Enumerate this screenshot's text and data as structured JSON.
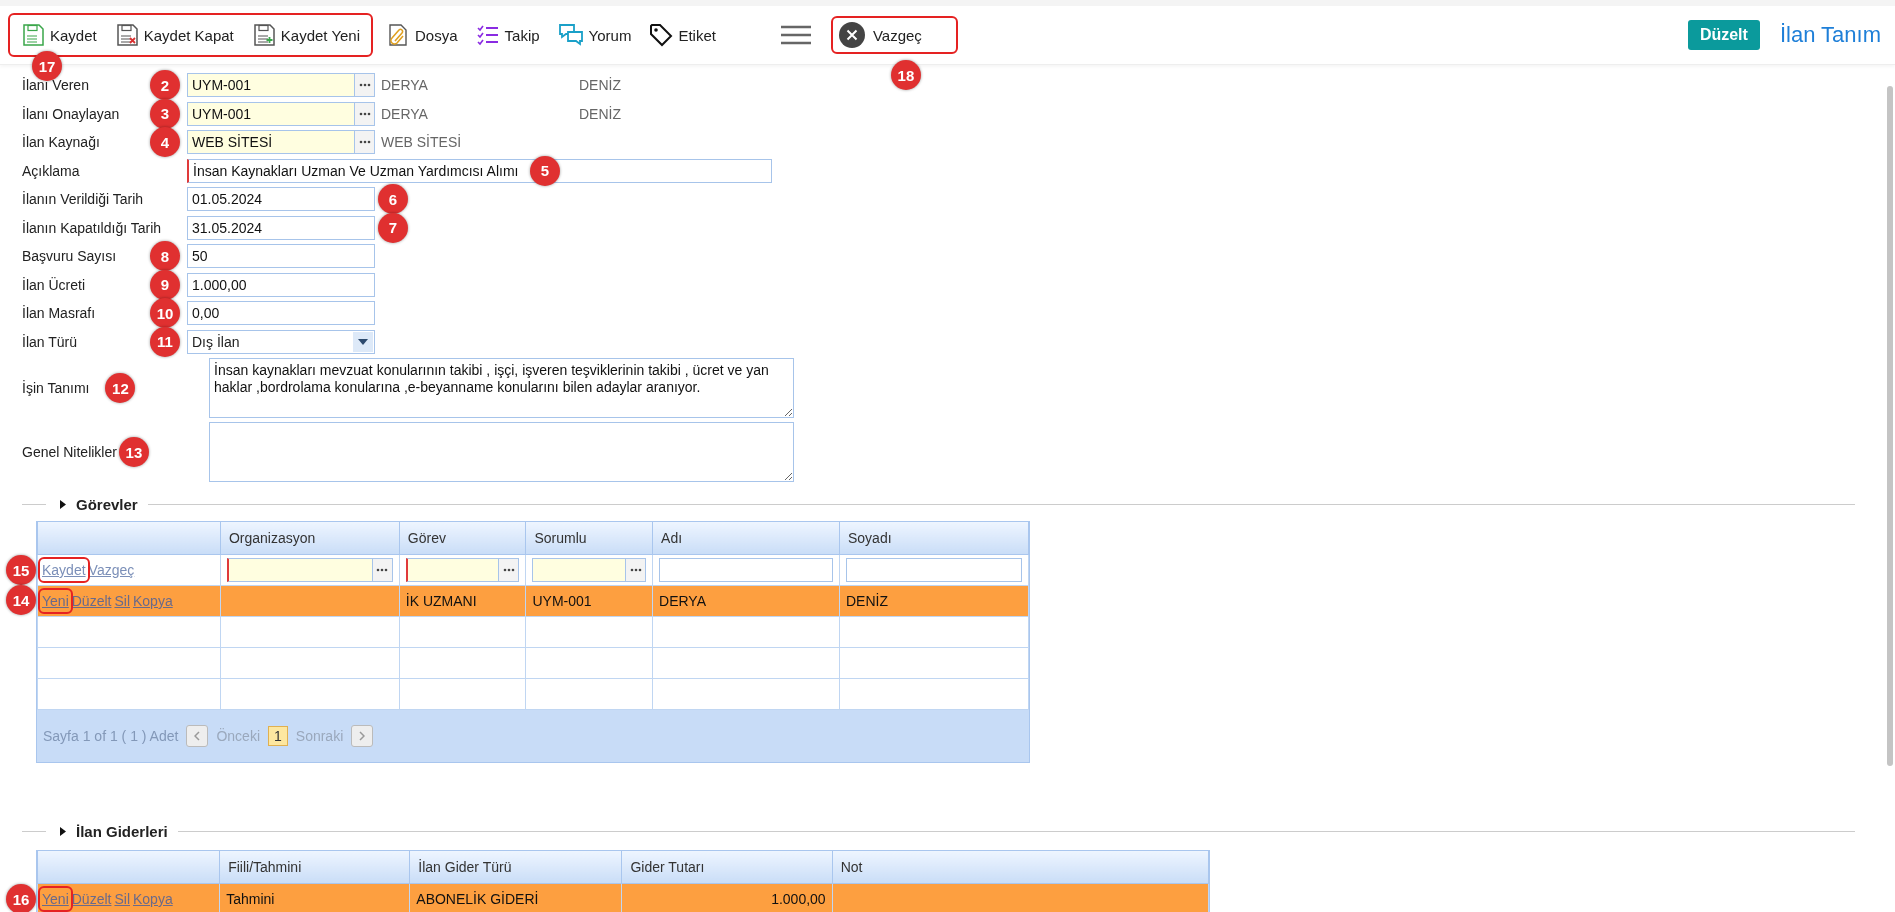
{
  "toolbar": {
    "groups": [
      {
        "highlighted": true,
        "callout": "17",
        "buttons": [
          {
            "label": "Kaydet",
            "kind": "save"
          },
          {
            "label": "Kaydet Kapat",
            "kind": "save-close"
          },
          {
            "label": "Kaydet Yeni",
            "kind": "save-new"
          }
        ]
      },
      {
        "highlighted": false,
        "buttons": [
          {
            "label": "Dosya",
            "kind": "file"
          },
          {
            "label": "Takip",
            "kind": "tasks"
          },
          {
            "label": "Yorum",
            "kind": "comments"
          },
          {
            "label": "Etiket",
            "kind": "tag"
          }
        ]
      }
    ],
    "cancel": {
      "label": "Vazgeç",
      "highlighted": true,
      "callout": "18"
    },
    "edit_button": "Düzelt",
    "page_title": "İlan Tanım"
  },
  "form": {
    "fields": [
      {
        "label": "İlanı Veren",
        "kind": "lookup",
        "value": "UYM-001",
        "required": false,
        "extra": [
          "DERYA",
          "DENİZ"
        ],
        "callout": "2"
      },
      {
        "label": "İlanı Onaylayan",
        "kind": "lookup",
        "value": "UYM-001",
        "required": false,
        "extra": [
          "DERYA",
          "DENİZ"
        ],
        "callout": "3"
      },
      {
        "label": "İlan Kaynağı",
        "kind": "lookup",
        "value": "WEB SİTESİ",
        "required": false,
        "extra": [
          "WEB SİTESİ"
        ],
        "callout": "4"
      },
      {
        "label": "Açıklama",
        "kind": "text",
        "value": "İnsan Kaynakları Uzman Ve Uzman Yardımcısı Alımı",
        "required": true,
        "callout": "5"
      },
      {
        "label": "İlanın Verildiği Tarih",
        "kind": "date",
        "value": "01.05.2024",
        "required": false,
        "callout": "6"
      },
      {
        "label": "İlanın Kapatıldığı Tarih",
        "kind": "date",
        "value": "31.05.2024",
        "required": false,
        "callout": "7"
      },
      {
        "label": "Başvuru Sayısı",
        "kind": "number",
        "value": "50",
        "required": false,
        "callout": "8"
      },
      {
        "label": "İlan Ücreti",
        "kind": "number",
        "value": "1.000,00",
        "required": false,
        "callout": "9"
      },
      {
        "label": "İlan Masrafı",
        "kind": "number",
        "value": "0,00",
        "required": false,
        "callout": "10"
      },
      {
        "label": "İlan Türü",
        "kind": "select",
        "value": "Dış İlan",
        "required": false,
        "callout": "11"
      },
      {
        "label": "İşin Tanımı",
        "kind": "textarea",
        "value": "İnsan kaynakları mevzuat konularının takibi , işçi, işveren teşviklerinin takibi , ücret ve yan haklar ,bordrolama konularına ,e-beyanname konularını bilen adaylar aranıyor.",
        "required": false,
        "callout": "12"
      },
      {
        "label": "Genel Nitelikler",
        "kind": "textarea",
        "required": false,
        "callout": "13"
      }
    ]
  },
  "tasks": {
    "title": "Görevler",
    "columns": [
      "Organizasyon",
      "Görev",
      "Sorumlu",
      "Adı",
      "Soyadı"
    ],
    "edit_row": {
      "callout": "15",
      "actions": [
        {
          "label": "Kaydet",
          "highlighted": true
        },
        {
          "label": "Vazgeç",
          "highlighted": false
        }
      ],
      "editors": [
        {
          "kind": "lookup",
          "required": true
        },
        {
          "kind": "lookup",
          "required": true
        },
        {
          "kind": "lookup",
          "required": false
        },
        {
          "kind": "text",
          "required": false
        },
        {
          "kind": "text",
          "required": false
        }
      ]
    },
    "rows": [
      {
        "selected": true,
        "callout": "14",
        "actions": [
          {
            "label": "Yeni",
            "highlighted": true
          },
          {
            "label": "Düzelt",
            "highlighted": false
          },
          {
            "label": "Sil",
            "highlighted": false
          },
          {
            "label": "Kopya",
            "highlighted": false
          }
        ],
        "cells": [
          "",
          "İK UZMANI",
          "UYM-001",
          "DERYA",
          "DENİZ"
        ]
      }
    ],
    "pager": {
      "summary": "Sayfa 1 of 1 ( 1 ) Adet",
      "prev": "Önceki",
      "page": "1",
      "next": "Sonraki"
    }
  },
  "expenses": {
    "title": "İlan Giderleri",
    "columns": [
      "Fiili/Tahmini",
      "İlan Gider Türü",
      "Gider Tutarı",
      "Not"
    ],
    "rows": [
      {
        "selected": true,
        "callout": "16",
        "actions": [
          {
            "label": "Yeni",
            "highlighted": true
          },
          {
            "label": "Düzelt",
            "highlighted": false
          },
          {
            "label": "Sil",
            "highlighted": false
          },
          {
            "label": "Kopya",
            "highlighted": false
          }
        ],
        "cells": [
          "Tahmini",
          "ABONELİK GİDERİ",
          "1.000,00",
          ""
        ]
      }
    ]
  }
}
